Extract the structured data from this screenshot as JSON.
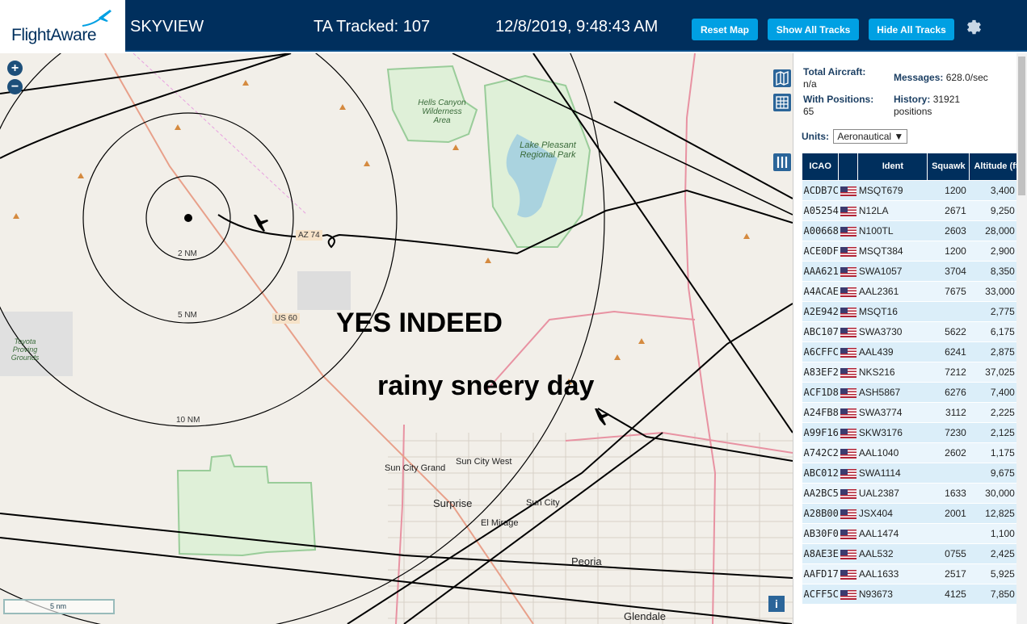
{
  "header": {
    "brand": "FlightAware",
    "app_title": "SKYVIEW",
    "tracked": "TA Tracked: 107",
    "clock": "12/8/2019, 9:48:43 AM",
    "buttons": {
      "reset": "Reset Map",
      "show": "Show All Tracks",
      "hide": "Hide All Tracks"
    },
    "colors": {
      "bar": "#002f5d",
      "button": "#00a0e3"
    }
  },
  "map": {
    "overlay_1": "YES INDEED",
    "overlay_2": "rainy sneery day",
    "zoom_in": "+",
    "zoom_out": "−",
    "scale": "5 nm",
    "info": "i",
    "ring_labels": {
      "r2": "2 NM",
      "r5": "5 NM",
      "r10": "10 NM"
    },
    "labels": {
      "hells_canyon": "Hells Canyon Wilderness Area",
      "lake_pleasant": "Lake Pleasant Regional Park",
      "yuma": "Toyota Proving Grounds",
      "sun_city_grand": "Sun City Grand",
      "sun_city_west": "Sun City West",
      "surprise": "Surprise",
      "sun_city": "Sun City",
      "el_mirage": "El Mirage",
      "peoria": "Peoria",
      "glendale": "Glendale",
      "us60": "US 60",
      "az74": "AZ 74"
    }
  },
  "sidebar": {
    "total_label": "Total Aircraft:",
    "total_value": "n/a",
    "messages_label": "Messages:",
    "messages_value": "628.0/sec",
    "positions_label": "With Positions:",
    "positions_value": "65",
    "history_label": "History:",
    "history_value": "31921 positions",
    "units_label": "Units:",
    "units_value": "Aeronautical ▼",
    "columns": {
      "icao": "ICAO",
      "ident": "Ident",
      "squawk": "Squawk",
      "altitude": "Altitude (ft)"
    },
    "rows": [
      {
        "icao": "ACDB7C",
        "ident": "MSQT679",
        "squawk": "1200",
        "alt": "3,400",
        "trend": ""
      },
      {
        "icao": "A05254",
        "ident": "N12LA",
        "squawk": "2671",
        "alt": "9,250",
        "trend": "▲"
      },
      {
        "icao": "A00668",
        "ident": "N100TL",
        "squawk": "2603",
        "alt": "28,000",
        "trend": ""
      },
      {
        "icao": "ACE0DF",
        "ident": "MSQT384",
        "squawk": "1200",
        "alt": "2,900",
        "trend": "▼"
      },
      {
        "icao": "AAA621",
        "ident": "SWA1057",
        "squawk": "3704",
        "alt": "8,350",
        "trend": "▼"
      },
      {
        "icao": "A4ACAE",
        "ident": "AAL2361",
        "squawk": "7675",
        "alt": "33,000",
        "trend": ""
      },
      {
        "icao": "A2E942",
        "ident": "MSQT16",
        "squawk": "",
        "alt": "2,775",
        "trend": "▼"
      },
      {
        "icao": "ABC107",
        "ident": "SWA3730",
        "squawk": "5622",
        "alt": "6,175",
        "trend": "▼"
      },
      {
        "icao": "A6CFFC",
        "ident": "AAL439",
        "squawk": "6241",
        "alt": "2,875",
        "trend": ""
      },
      {
        "icao": "A83EF2",
        "ident": "NKS216",
        "squawk": "7212",
        "alt": "37,025",
        "trend": ""
      },
      {
        "icao": "ACF1D8",
        "ident": "ASH5867",
        "squawk": "6276",
        "alt": "7,400",
        "trend": "▼"
      },
      {
        "icao": "A24FB8",
        "ident": "SWA3774",
        "squawk": "3112",
        "alt": "2,225",
        "trend": "▼"
      },
      {
        "icao": "A99F16",
        "ident": "SKW3176",
        "squawk": "7230",
        "alt": "2,125",
        "trend": "▼"
      },
      {
        "icao": "A742C2",
        "ident": "AAL1040",
        "squawk": "2602",
        "alt": "1,175",
        "trend": "▼"
      },
      {
        "icao": "ABC012",
        "ident": "SWA1114",
        "squawk": "",
        "alt": "9,675",
        "trend": "▼"
      },
      {
        "icao": "AA2BC5",
        "ident": "UAL2387",
        "squawk": "1633",
        "alt": "30,000",
        "trend": ""
      },
      {
        "icao": "A28B00",
        "ident": "JSX404",
        "squawk": "2001",
        "alt": "12,825",
        "trend": "▼"
      },
      {
        "icao": "AB30F0",
        "ident": "AAL1474",
        "squawk": "",
        "alt": "1,100",
        "trend": ""
      },
      {
        "icao": "A8AE3E",
        "ident": "AAL532",
        "squawk": "0755",
        "alt": "2,425",
        "trend": "▲"
      },
      {
        "icao": "AAFD17",
        "ident": "AAL1633",
        "squawk": "2517",
        "alt": "5,925",
        "trend": "▼"
      },
      {
        "icao": "ACFF5C",
        "ident": "N93673",
        "squawk": "4125",
        "alt": "7,850",
        "trend": "▼"
      }
    ]
  },
  "icons": [
    "flightaware-logo-plane-icon",
    "gear-icon",
    "zoom-in-icon",
    "zoom-out-icon",
    "map-layers-icon",
    "grid-icon",
    "columns-icon",
    "info-icon",
    "us-flag-icon",
    "aircraft-icon"
  ]
}
